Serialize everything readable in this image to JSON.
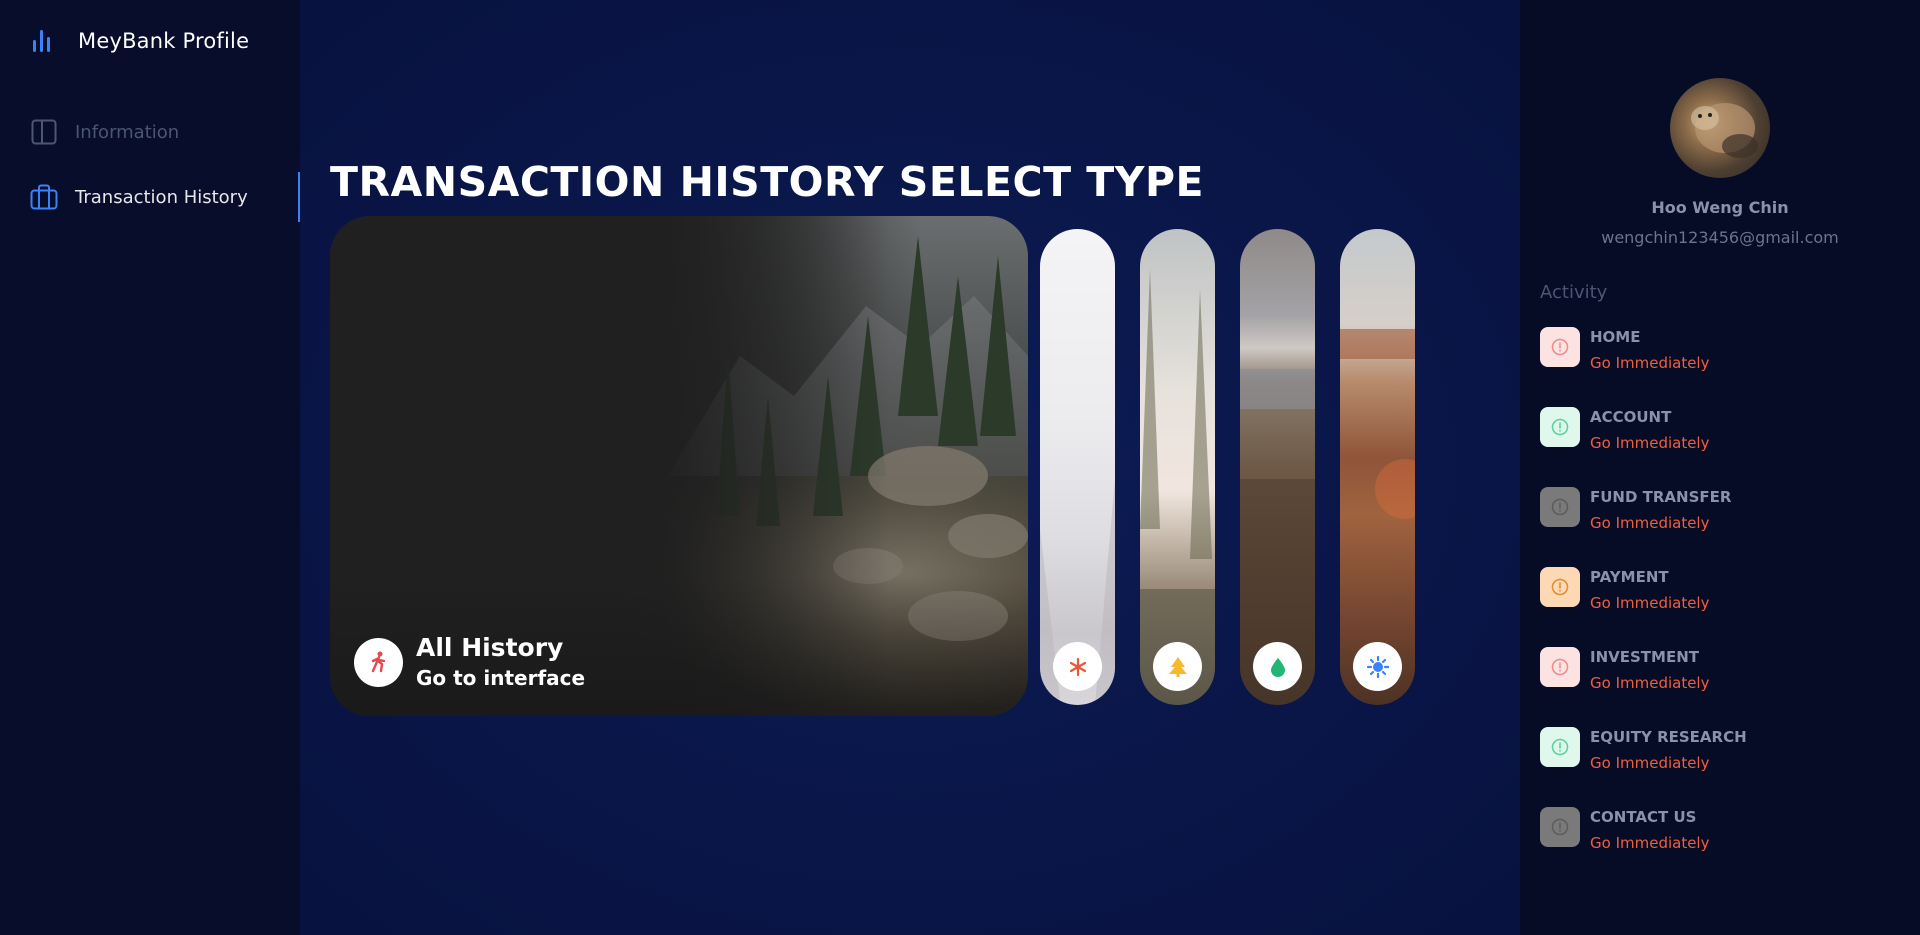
{
  "sidebar": {
    "brand": "MeyBank Profile",
    "items": [
      {
        "label": "Information",
        "icon": "layout-icon"
      },
      {
        "label": "Transaction History",
        "icon": "briefcase-icon"
      }
    ]
  },
  "main": {
    "title": "TRANSACTION HISTORY SELECT TYPE",
    "featured_card": {
      "title": "All History",
      "subtitle": "Go to interface",
      "icon": "walking-person-icon"
    },
    "cards": [
      {
        "icon": "snowflake-icon"
      },
      {
        "icon": "tree-icon"
      },
      {
        "icon": "drop-icon"
      },
      {
        "icon": "sun-icon"
      }
    ]
  },
  "profile": {
    "name": "Hoo Weng Chin",
    "email": "wengchin123456@gmail.com"
  },
  "activity": {
    "title": "Activity",
    "items": [
      {
        "label": "HOME",
        "link": "Go Immediately",
        "icon_bg": "#fde2e2",
        "icon_color": "#f08a8a"
      },
      {
        "label": "ACCOUNT",
        "link": "Go Immediately",
        "icon_bg": "#e0f7ec",
        "icon_color": "#5ad39a"
      },
      {
        "label": "FUND TRANSFER",
        "link": "Go Immediately",
        "icon_bg": "#7a7a7a",
        "icon_color": "#5c5c5c"
      },
      {
        "label": "PAYMENT",
        "link": "Go Immediately",
        "icon_bg": "#fcd9b4",
        "icon_color": "#e58a2e"
      },
      {
        "label": "INVESTMENT",
        "link": "Go Immediately",
        "icon_bg": "#fde2e2",
        "icon_color": "#f08a8a"
      },
      {
        "label": "EQUITY RESEARCH",
        "link": "Go Immediately",
        "icon_bg": "#e0f7ec",
        "icon_color": "#5ad39a"
      },
      {
        "label": "CONTACT US",
        "link": "Go Immediately",
        "icon_bg": "#7a7a7a",
        "icon_color": "#5c5c5c"
      }
    ]
  },
  "colors": {
    "accent": "#3b82f6",
    "link": "#ee5f3c"
  }
}
